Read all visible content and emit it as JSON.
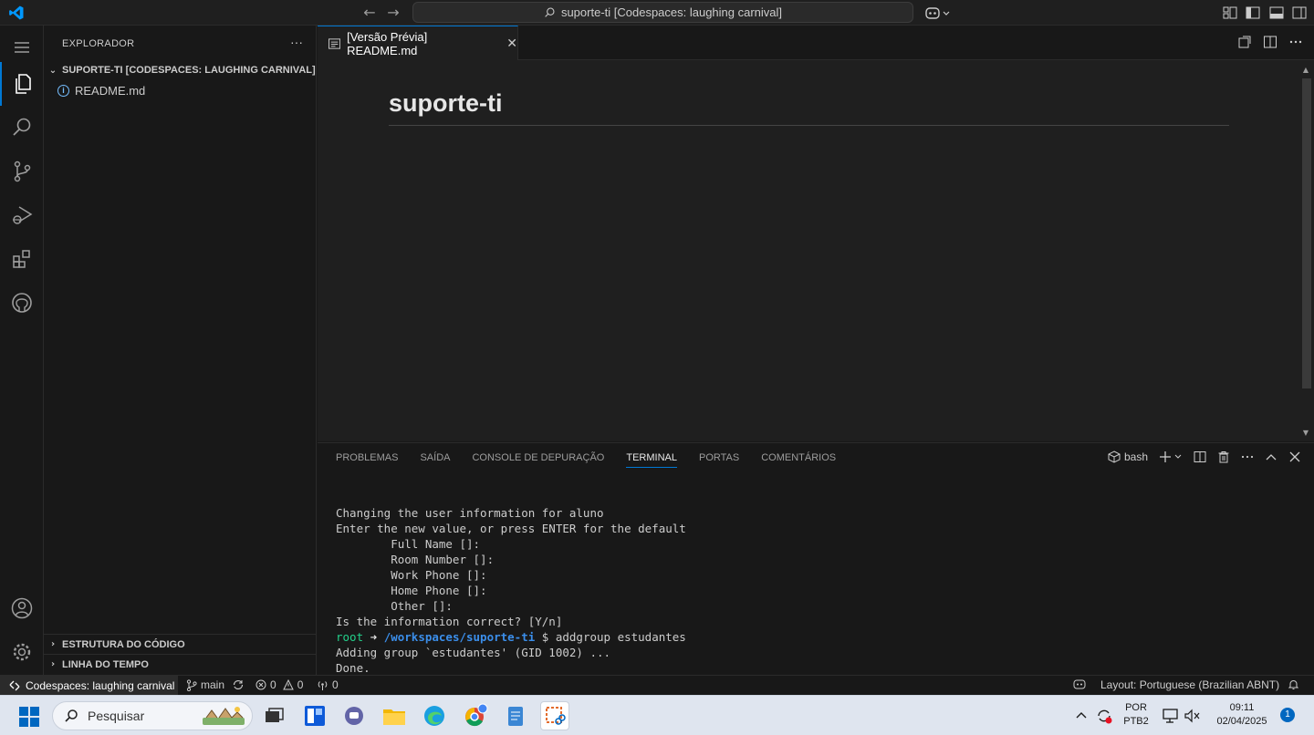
{
  "titlebar": {
    "command_center_text": "suporte-ti [Codespaces: laughing carnival]",
    "accent": "#0078d4"
  },
  "sidebar": {
    "header": "EXPLORADOR",
    "more": "···",
    "workspace": "SUPORTE-TI [CODESPACES: LAUGHING CARNIVAL]",
    "files": [
      {
        "name": "README.md",
        "icon": "info-icon"
      }
    ],
    "sections": [
      "ESTRUTURA DO CÓDIGO",
      "LINHA DO TEMPO"
    ]
  },
  "editor": {
    "tab_label": "[Versão Prévia] README.md",
    "tab_close": "✕",
    "heading": "suporte-ti"
  },
  "panel": {
    "tabs": [
      "PROBLEMAS",
      "SAÍDA",
      "CONSOLE DE DEPURAÇÃO",
      "TERMINAL",
      "PORTAS",
      "COMENTÁRIOS"
    ],
    "active_tab": "TERMINAL",
    "shell": "bash"
  },
  "terminal": {
    "lines": [
      "Changing the user information for aluno",
      "Enter the new value, or press ENTER for the default",
      "        Full Name []:",
      "        Room Number []:",
      "        Work Phone []:",
      "        Home Phone []:",
      "        Other []:",
      "Is the information correct? [Y/n]"
    ],
    "prompt_user": "root",
    "prompt_arrow": " ➜ ",
    "prompt_path": "/workspaces/suporte-ti",
    "prompt_dollar": " $ ",
    "command1": "addgroup estudantes",
    "output": [
      "Adding group `estudantes' (GID 1002) ...",
      "Done."
    ]
  },
  "statusbar": {
    "remote": "Codespaces: laughing carnival",
    "branch": "main",
    "errors": "0",
    "warnings": "0",
    "ports": "0",
    "layout": "Layout: Portuguese (Brazilian ABNT)"
  },
  "taskbar": {
    "search_placeholder": "Pesquisar",
    "lang_top": "POR",
    "lang_bottom": "PTB2",
    "time": "09:11",
    "date": "02/04/2025",
    "notifications": "1"
  }
}
